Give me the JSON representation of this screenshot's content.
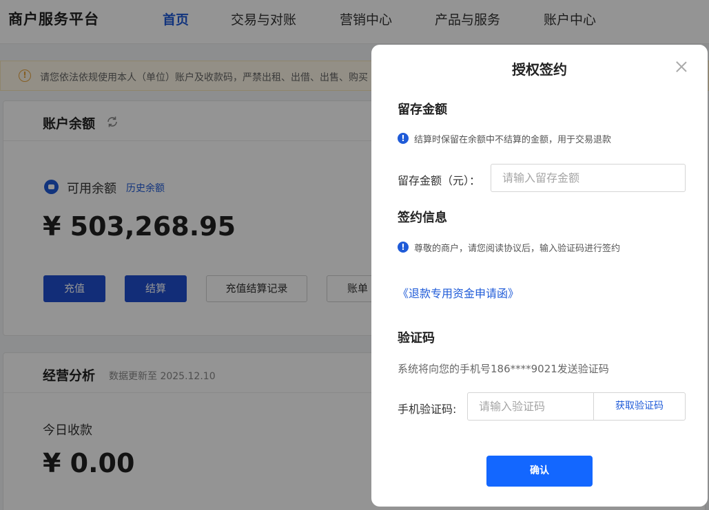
{
  "header": {
    "brand": "商户服务平台",
    "nav": [
      {
        "label": "首页",
        "active": true
      },
      {
        "label": "交易与对账",
        "active": false
      },
      {
        "label": "营销中心",
        "active": false
      },
      {
        "label": "产品与服务",
        "active": false
      },
      {
        "label": "账户中心",
        "active": false
      }
    ]
  },
  "notice": {
    "icon": "warning-icon",
    "text": "请您依法依规使用本人（单位）账户及收款码，严禁出租、出借、出售、购买"
  },
  "balance_card": {
    "title": "账户余额",
    "refresh_icon": "refresh-icon",
    "available_label": "可用余额",
    "history_link": "历史余额",
    "amount": "¥ 503,268.95",
    "buttons": {
      "recharge": "充值",
      "settle": "结算",
      "records": "充值结算记录",
      "bill": "账单"
    }
  },
  "analysis_card": {
    "title": "经营分析",
    "update_text": "数据更新至 2025.12.10",
    "today_label": "今日收款",
    "today_amount": "¥ 0.00"
  },
  "modal": {
    "title": "授权签约",
    "retention": {
      "section_title": "留存金额",
      "info": "结算时保留在余额中不结算的金额，用于交易退款",
      "label": "留存金额（元）：",
      "placeholder": "请输入留存金额",
      "value": ""
    },
    "signing": {
      "section_title": "签约信息",
      "info": "尊敬的商户，请您阅读协议后，输入验证码进行签约",
      "agreement_link": "《退款专用资金申请函》"
    },
    "verification": {
      "section_title": "验证码",
      "sms_text": "系统将向您的手机号186****9021发送验证码",
      "label": "手机验证码:",
      "placeholder": "请输入验证码",
      "value": "",
      "get_code": "获取验证码"
    },
    "confirm": "确认"
  },
  "colors": {
    "primary": "#1f5bd8",
    "confirm": "#1367ff",
    "warning": "#e6a23c"
  }
}
